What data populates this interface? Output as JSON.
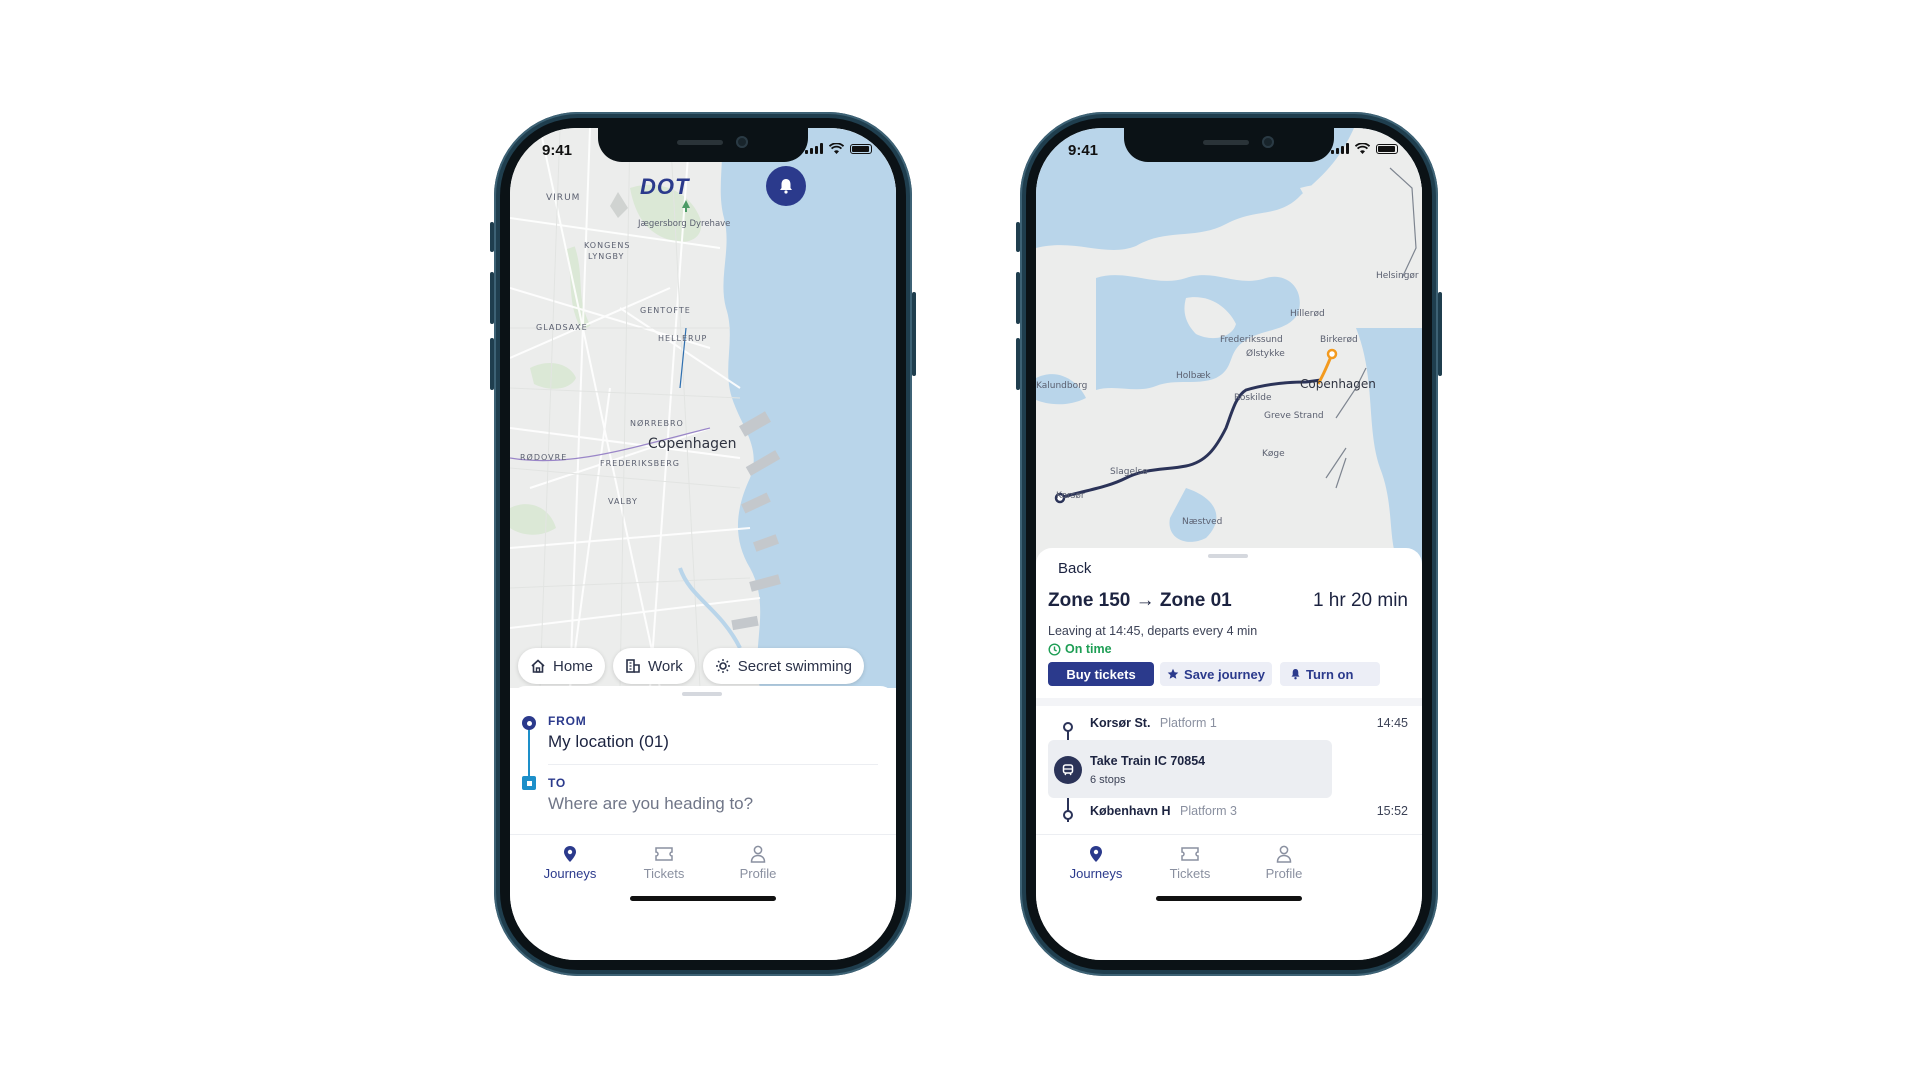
{
  "left_phone": {
    "status_time": "9:41",
    "brand": "DOT",
    "map": {
      "labels": [
        "VIRUM",
        "Jægersborg Dyrehave",
        "KONGENS",
        "LYNGBY",
        "GENTOFTE",
        "GLADSAXE",
        "HELLERUP",
        "NØRREBRO",
        "Copenhagen",
        "RØDOVRE",
        "FREDERIKSBERG",
        "VALBY"
      ]
    },
    "quick_places": [
      {
        "label": "Home",
        "icon": "home-icon"
      },
      {
        "label": "Work",
        "icon": "building-icon"
      },
      {
        "label": "Secret swimming",
        "icon": "sun-icon"
      }
    ],
    "from": {
      "label": "FROM",
      "value": "My location (01)"
    },
    "to": {
      "label": "TO",
      "placeholder": "Where are you heading to?"
    },
    "nav": {
      "journeys": "Journeys",
      "tickets": "Tickets",
      "profile": "Profile"
    }
  },
  "right_phone": {
    "status_time": "9:41",
    "map": {
      "labels": [
        "Helsingør",
        "Hillerød",
        "Frederikssund",
        "Birkerød",
        "Ølstykke",
        "Holbæk",
        "Kalundborg",
        "Copenhagen",
        "Roskilde",
        "Greve Strand",
        "Køge",
        "Slagelse",
        "Korsør",
        "Næstved"
      ]
    },
    "back_label": "Back",
    "journey": {
      "zones": "Zone 150 → Zone 01",
      "duration": "1 hr 20 min",
      "leaving": "Leaving at 14:45, departs every 4 min",
      "status": "On time"
    },
    "actions": {
      "buy": "Buy tickets",
      "save": "Save journey",
      "notify": "Turn on"
    },
    "legs": {
      "start": {
        "station": "Korsør St.",
        "platform": "Platform 1",
        "time": "14:45"
      },
      "ride": {
        "title": "Take Train IC 70854",
        "stops": "6 stops"
      },
      "end": {
        "station": "København H",
        "platform": "Platform 3",
        "time": "15:52"
      }
    },
    "nav": {
      "journeys": "Journeys",
      "tickets": "Tickets",
      "profile": "Profile"
    }
  },
  "colors": {
    "brand_navy": "#2b3a8c",
    "on_time_green": "#1e9e55",
    "route_orange": "#f39a1e",
    "water": "#b9d5ea",
    "land": "#ecedec"
  }
}
